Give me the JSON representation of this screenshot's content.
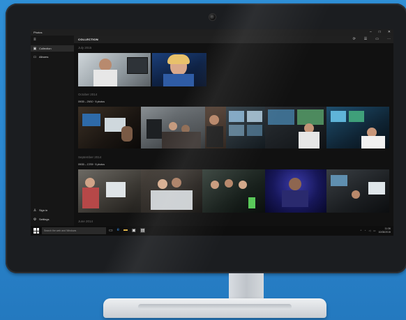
{
  "app": {
    "title": "Photos",
    "window_controls": [
      "–",
      "□",
      "✕"
    ]
  },
  "sidebar": {
    "menu_icon": "hamburger-icon",
    "items": [
      {
        "label": "Collection",
        "icon": "collection-icon",
        "active": true
      },
      {
        "label": "Albums",
        "icon": "albums-icon",
        "active": false
      }
    ],
    "footer_items": [
      {
        "label": "Sign in",
        "icon": "person-icon"
      },
      {
        "label": "Settings",
        "icon": "gear-icon"
      }
    ]
  },
  "main": {
    "title": "COLLECTION",
    "toolbar_icons": [
      "refresh-icon",
      "select-icon",
      "slideshow-icon",
      "more-icon"
    ],
    "sections": [
      {
        "title": "July 2015",
        "group_label": ""
      },
      {
        "title": "October 2014",
        "group_label": "09/30 – 29/10 · 5 photos"
      },
      {
        "title": "September 2014",
        "group_label": "09/30 – 17/09 · 5 photos"
      },
      {
        "title": "June 2014",
        "group_label": ""
      }
    ]
  },
  "taskbar": {
    "search_placeholder": "Search the web and Windows",
    "time": "11:36",
    "date": "10/08/2015"
  },
  "colors": {
    "wallpaper": "#2a86cf",
    "screen_bg": "#111111",
    "sidebar_bg": "#161616",
    "accent": "#2d7fd0"
  }
}
